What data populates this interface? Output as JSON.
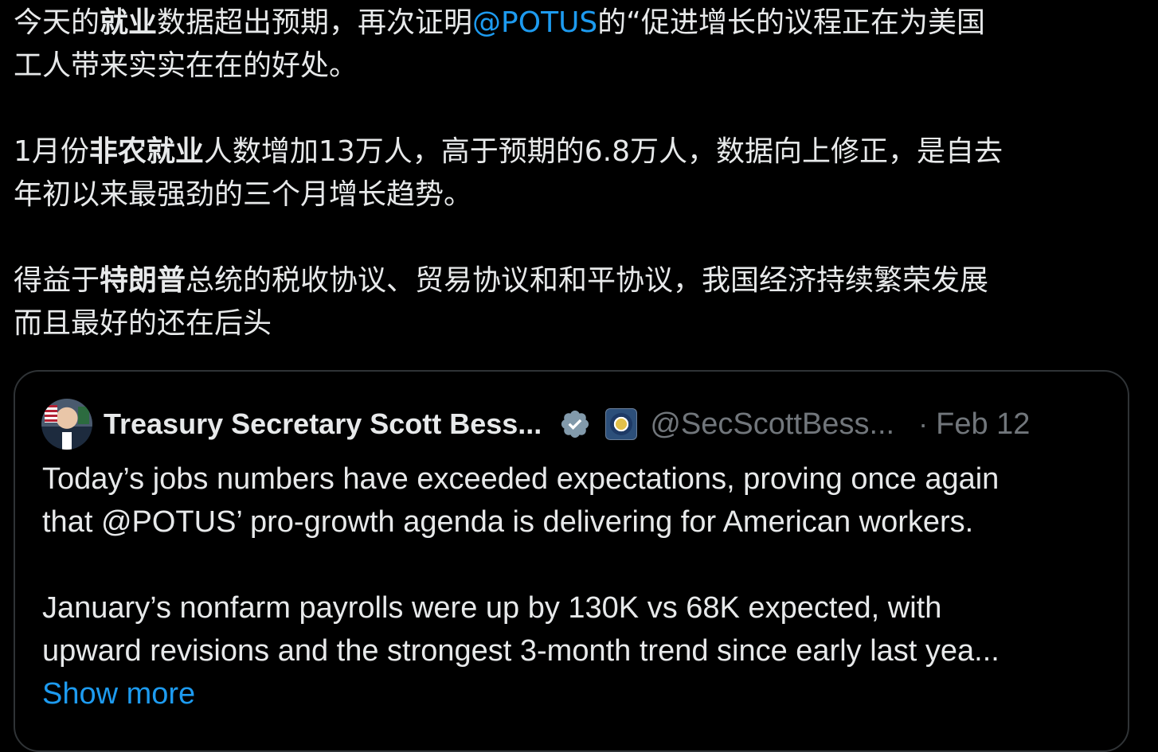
{
  "tweet": {
    "paragraphs": [
      [
        [
          {
            "t": "今天的",
            "b": false
          },
          {
            "t": "就业",
            "b": true
          },
          {
            "t": "数据超出预期，再次证明",
            "b": false
          },
          {
            "t": "@POTUS",
            "m": true
          },
          {
            "t": "的“促进增长的议程正在为美国",
            "b": false
          }
        ],
        [
          {
            "t": "工人带来实实在在的好处。",
            "b": false
          }
        ]
      ],
      [
        [
          {
            "t": "1月份",
            "b": false
          },
          {
            "t": "非农就业",
            "b": true
          },
          {
            "t": "人数增加13万人，高于预期的6.8万人，数据向上修正，是自去",
            "b": false
          }
        ],
        [
          {
            "t": "年初以来最强劲的三个月增长趋势。",
            "b": false
          }
        ]
      ],
      [
        [
          {
            "t": "得益于",
            "b": false
          },
          {
            "t": "特朗普",
            "b": true
          },
          {
            "t": "总统的税收协议、贸易协议和和平协议，我国经济持续繁荣发展",
            "b": false
          }
        ],
        [
          {
            "t": "而且最好的还在后头",
            "b": false
          }
        ]
      ]
    ]
  },
  "quote": {
    "author_name": "Treasury Secretary Scott Bess...",
    "handle": "@SecScottBess...",
    "separator": "·",
    "timestamp": "Feb 12",
    "body_lines": [
      [
        "Today’s jobs numbers have exceeded expectations, proving once again",
        "that @POTUS’ pro-growth agenda is delivering for American workers."
      ],
      [
        "January’s nonfarm payrolls were up by 130K vs 68K expected, with",
        "upward revisions and the strongest 3-month trend since early last yea..."
      ]
    ],
    "show_more_label": "Show more"
  },
  "colors": {
    "background": "#000000",
    "text": "#e7e9ea",
    "secondary": "#71767b",
    "link": "#1d9bf0",
    "border": "#2f3336",
    "verified": "#829aab"
  }
}
